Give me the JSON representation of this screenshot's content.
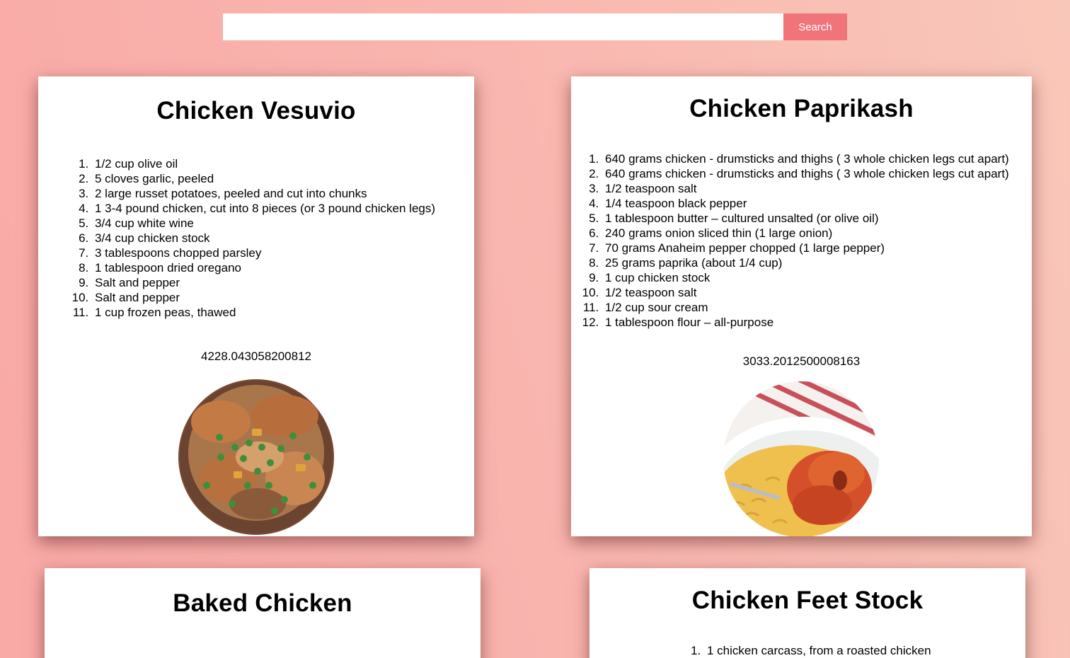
{
  "search": {
    "value": "",
    "placeholder": "",
    "button_label": "Search"
  },
  "recipes": [
    {
      "title": "Chicken Vesuvio",
      "ingredients": [
        "1/2 cup olive oil",
        "5 cloves garlic, peeled",
        "2 large russet potatoes, peeled and cut into chunks",
        "1 3-4 pound chicken, cut into 8 pieces (or 3 pound chicken legs)",
        "3/4 cup white wine",
        "3/4 cup chicken stock",
        "3 tablespoons chopped parsley",
        "1 tablespoon dried oregano",
        "Salt and pepper",
        "Salt and pepper",
        "1 cup frozen peas, thawed"
      ],
      "calories": "4228.043058200812",
      "photo_icon": "chicken-vesuvio-photo"
    },
    {
      "title": "Chicken Paprikash",
      "ingredients": [
        "640 grams chicken - drumsticks and thighs ( 3 whole chicken legs cut apart)",
        "640 grams chicken - drumsticks and thighs ( 3 whole chicken legs cut apart)",
        "1/2 teaspoon salt",
        "1/4 teaspoon black pepper",
        "1 tablespoon butter – cultured unsalted (or olive oil)",
        "240 grams onion sliced thin (1 large onion)",
        "70 grams Anaheim pepper chopped (1 large pepper)",
        "25 grams paprika (about 1/4 cup)",
        "1 cup chicken stock",
        "1/2 teaspoon salt",
        "1/2 cup sour cream",
        "1 tablespoon flour – all-purpose"
      ],
      "calories": "3033.2012500008163",
      "photo_icon": "chicken-paprikash-photo"
    },
    {
      "title": "Baked Chicken",
      "ingredients": [],
      "calories": "",
      "photo_icon": ""
    },
    {
      "title": "Chicken Feet Stock",
      "ingredients": [
        "1 chicken carcass, from a roasted chicken"
      ],
      "calories": "",
      "photo_icon": ""
    }
  ],
  "colors": {
    "background_start": "#f9a9a6",
    "background_end": "#f9c7b9",
    "search_button": "#f0747a",
    "card": "#ffffff"
  }
}
